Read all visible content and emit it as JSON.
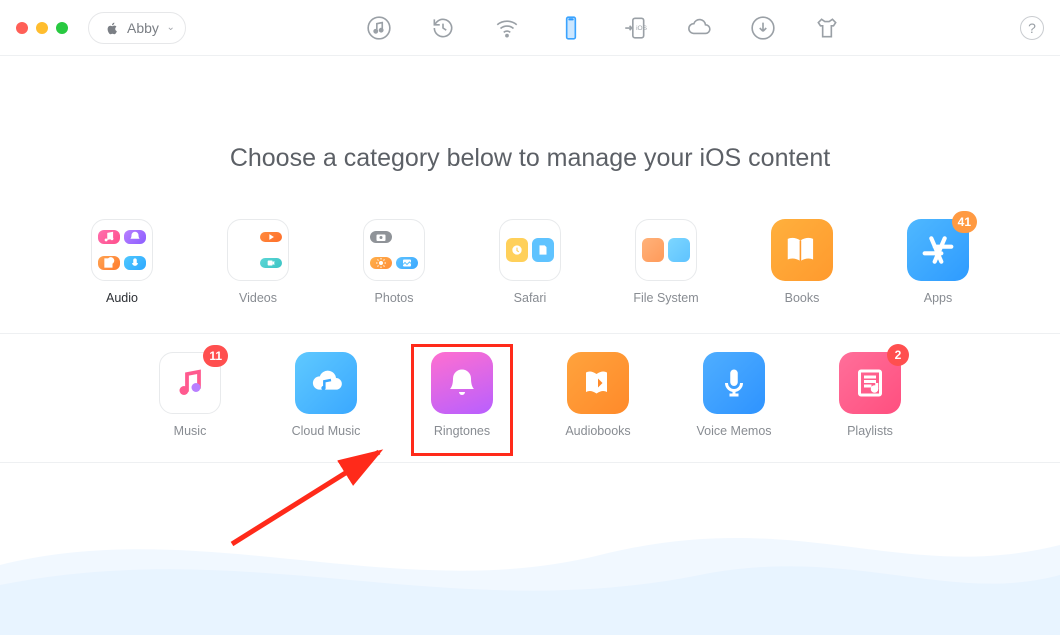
{
  "device": {
    "name": "Abby"
  },
  "heading": "Choose a category below to manage your iOS content",
  "categories_top": [
    {
      "label": "Audio",
      "selected": true
    },
    {
      "label": "Videos"
    },
    {
      "label": "Photos"
    },
    {
      "label": "Safari"
    },
    {
      "label": "File System"
    },
    {
      "label": "Books"
    },
    {
      "label": "Apps",
      "badge": "41"
    }
  ],
  "categories_sub": [
    {
      "label": "Music",
      "badge": "11"
    },
    {
      "label": "Cloud Music"
    },
    {
      "label": "Ringtones",
      "highlighted": true
    },
    {
      "label": "Audiobooks"
    },
    {
      "label": "Voice Memos"
    },
    {
      "label": "Playlists",
      "badge": "2"
    }
  ],
  "help": "?"
}
